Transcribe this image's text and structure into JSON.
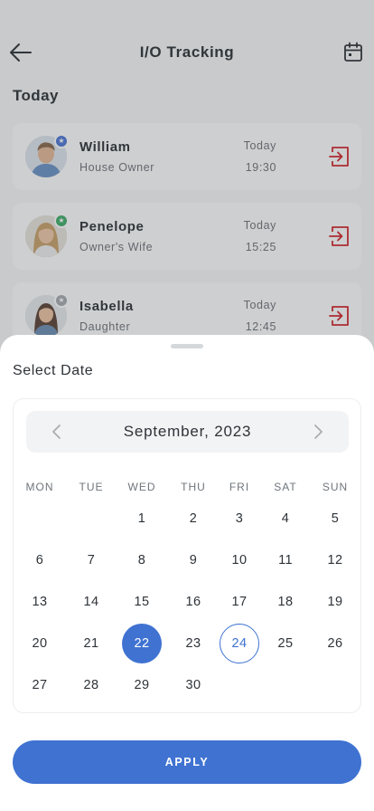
{
  "header": {
    "title": "I/O Tracking",
    "back_icon": "arrow-left-icon",
    "calendar_icon": "calendar-icon"
  },
  "section": {
    "title": "Today"
  },
  "entries": [
    {
      "name": "William",
      "role": "House Owner",
      "day": "Today",
      "time": "19:30",
      "badge_color": "#4e77d6",
      "io_icon": "login-icon"
    },
    {
      "name": "Penelope",
      "role": "Owner's Wife",
      "day": "Today",
      "time": "15:25",
      "badge_color": "#3fae6b",
      "io_icon": "login-icon"
    },
    {
      "name": "Isabella",
      "role": "Daughter",
      "day": "Today",
      "time": "12:45",
      "badge_color": "#a6abb1",
      "io_icon": "login-icon"
    }
  ],
  "sheet": {
    "title": "Select Date",
    "month_label": "September, 2023",
    "weekdays": [
      "MON",
      "TUE",
      "WED",
      "THU",
      "FRI",
      "SAT",
      "SUN"
    ],
    "first_weekday_index": 2,
    "days_in_month": 30,
    "selected_day": 22,
    "today_day": 24,
    "apply_label": "APPLY"
  },
  "colors": {
    "accent": "#3f72d1",
    "exit_red": "#d2262d"
  }
}
